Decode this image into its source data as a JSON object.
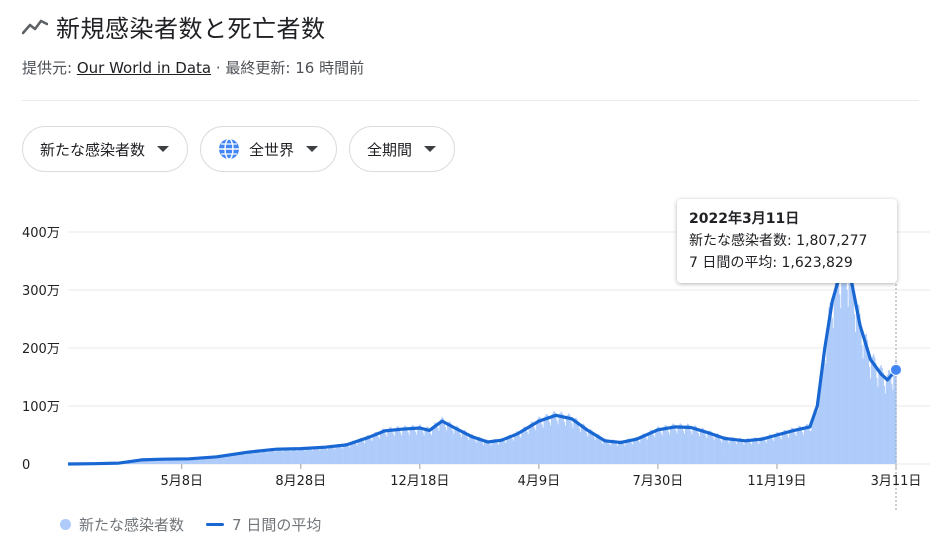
{
  "header": {
    "title": "新規感染者数と死亡者数",
    "icon": "trend-icon"
  },
  "source": {
    "prefix": "提供元: ",
    "link": "Our World in Data",
    "suffix": " · 最終更新: 16 時間前"
  },
  "chips": {
    "metric": "新たな感染者数",
    "region": "全世界",
    "period": "全期間"
  },
  "tooltip": {
    "date": "2022年3月11日",
    "line1": "新たな感染者数: 1,807,277",
    "line2": "7 日間の平均: 1,623,829"
  },
  "legend": {
    "daily": "新たな感染者数",
    "avg": "7 日間の平均"
  },
  "colors": {
    "bar": "#aecbfa",
    "line": "#1967d2",
    "grid": "#e8eaed",
    "text": "#70757a"
  },
  "chart_data": {
    "type": "bar",
    "title": "",
    "xlabel": "",
    "ylabel": "",
    "ylim": [
      0,
      4000000
    ],
    "yticks": [
      {
        "value": 0,
        "label": "0"
      },
      {
        "value": 1000000,
        "label": "100万"
      },
      {
        "value": 2000000,
        "label": "200万"
      },
      {
        "value": 3000000,
        "label": "300万"
      },
      {
        "value": 4000000,
        "label": "400万"
      }
    ],
    "xlim": [
      "2020-01-22",
      "2022-03-11"
    ],
    "xticks": [
      {
        "date": "2020-05-08",
        "label": "5月8日"
      },
      {
        "date": "2020-08-28",
        "label": "8月28日"
      },
      {
        "date": "2020-12-18",
        "label": "12月18日"
      },
      {
        "date": "2021-04-09",
        "label": "4月9日"
      },
      {
        "date": "2021-07-30",
        "label": "7月30日"
      },
      {
        "date": "2021-11-19",
        "label": "11月19日"
      },
      {
        "date": "2022-03-11",
        "label": "3月11日"
      }
    ],
    "series": [
      {
        "name": "7 日間の平均",
        "kind": "line",
        "points": [
          [
            "2020-01-22",
            0
          ],
          [
            "2020-02-15",
            5000
          ],
          [
            "2020-03-10",
            15000
          ],
          [
            "2020-03-31",
            70000
          ],
          [
            "2020-04-20",
            82000
          ],
          [
            "2020-05-15",
            90000
          ],
          [
            "2020-06-10",
            125000
          ],
          [
            "2020-07-10",
            205000
          ],
          [
            "2020-08-05",
            255000
          ],
          [
            "2020-08-28",
            265000
          ],
          [
            "2020-09-20",
            290000
          ],
          [
            "2020-10-10",
            330000
          ],
          [
            "2020-10-31",
            460000
          ],
          [
            "2020-11-15",
            570000
          ],
          [
            "2020-12-01",
            600000
          ],
          [
            "2020-12-18",
            620000
          ],
          [
            "2020-12-27",
            580000
          ],
          [
            "2021-01-08",
            740000
          ],
          [
            "2021-01-20",
            620000
          ],
          [
            "2021-02-05",
            470000
          ],
          [
            "2021-02-20",
            380000
          ],
          [
            "2021-03-05",
            410000
          ],
          [
            "2021-03-20",
            520000
          ],
          [
            "2021-04-09",
            740000
          ],
          [
            "2021-04-25",
            840000
          ],
          [
            "2021-05-10",
            780000
          ],
          [
            "2021-05-25",
            580000
          ],
          [
            "2021-06-10",
            400000
          ],
          [
            "2021-06-25",
            370000
          ],
          [
            "2021-07-10",
            430000
          ],
          [
            "2021-07-30",
            590000
          ],
          [
            "2021-08-15",
            640000
          ],
          [
            "2021-08-30",
            630000
          ],
          [
            "2021-09-15",
            540000
          ],
          [
            "2021-10-01",
            440000
          ],
          [
            "2021-10-20",
            400000
          ],
          [
            "2021-11-05",
            430000
          ],
          [
            "2021-11-19",
            500000
          ],
          [
            "2021-12-05",
            580000
          ],
          [
            "2021-12-20",
            640000
          ],
          [
            "2021-12-27",
            1000000
          ],
          [
            "2022-01-03",
            2000000
          ],
          [
            "2022-01-10",
            2800000
          ],
          [
            "2022-01-17",
            3250000
          ],
          [
            "2022-01-22",
            3400000
          ],
          [
            "2022-01-27",
            3250000
          ],
          [
            "2022-02-05",
            2400000
          ],
          [
            "2022-02-15",
            1800000
          ],
          [
            "2022-02-25",
            1550000
          ],
          [
            "2022-03-03",
            1450000
          ],
          [
            "2022-03-11",
            1623829
          ]
        ]
      },
      {
        "name": "新たな感染者数",
        "kind": "bars",
        "note_values": "daily values track the 7-day average with weekday variation",
        "highlight": {
          "date": "2022-03-11",
          "value": 1807277
        }
      }
    ],
    "legend": "bottom-left",
    "grid": true
  }
}
